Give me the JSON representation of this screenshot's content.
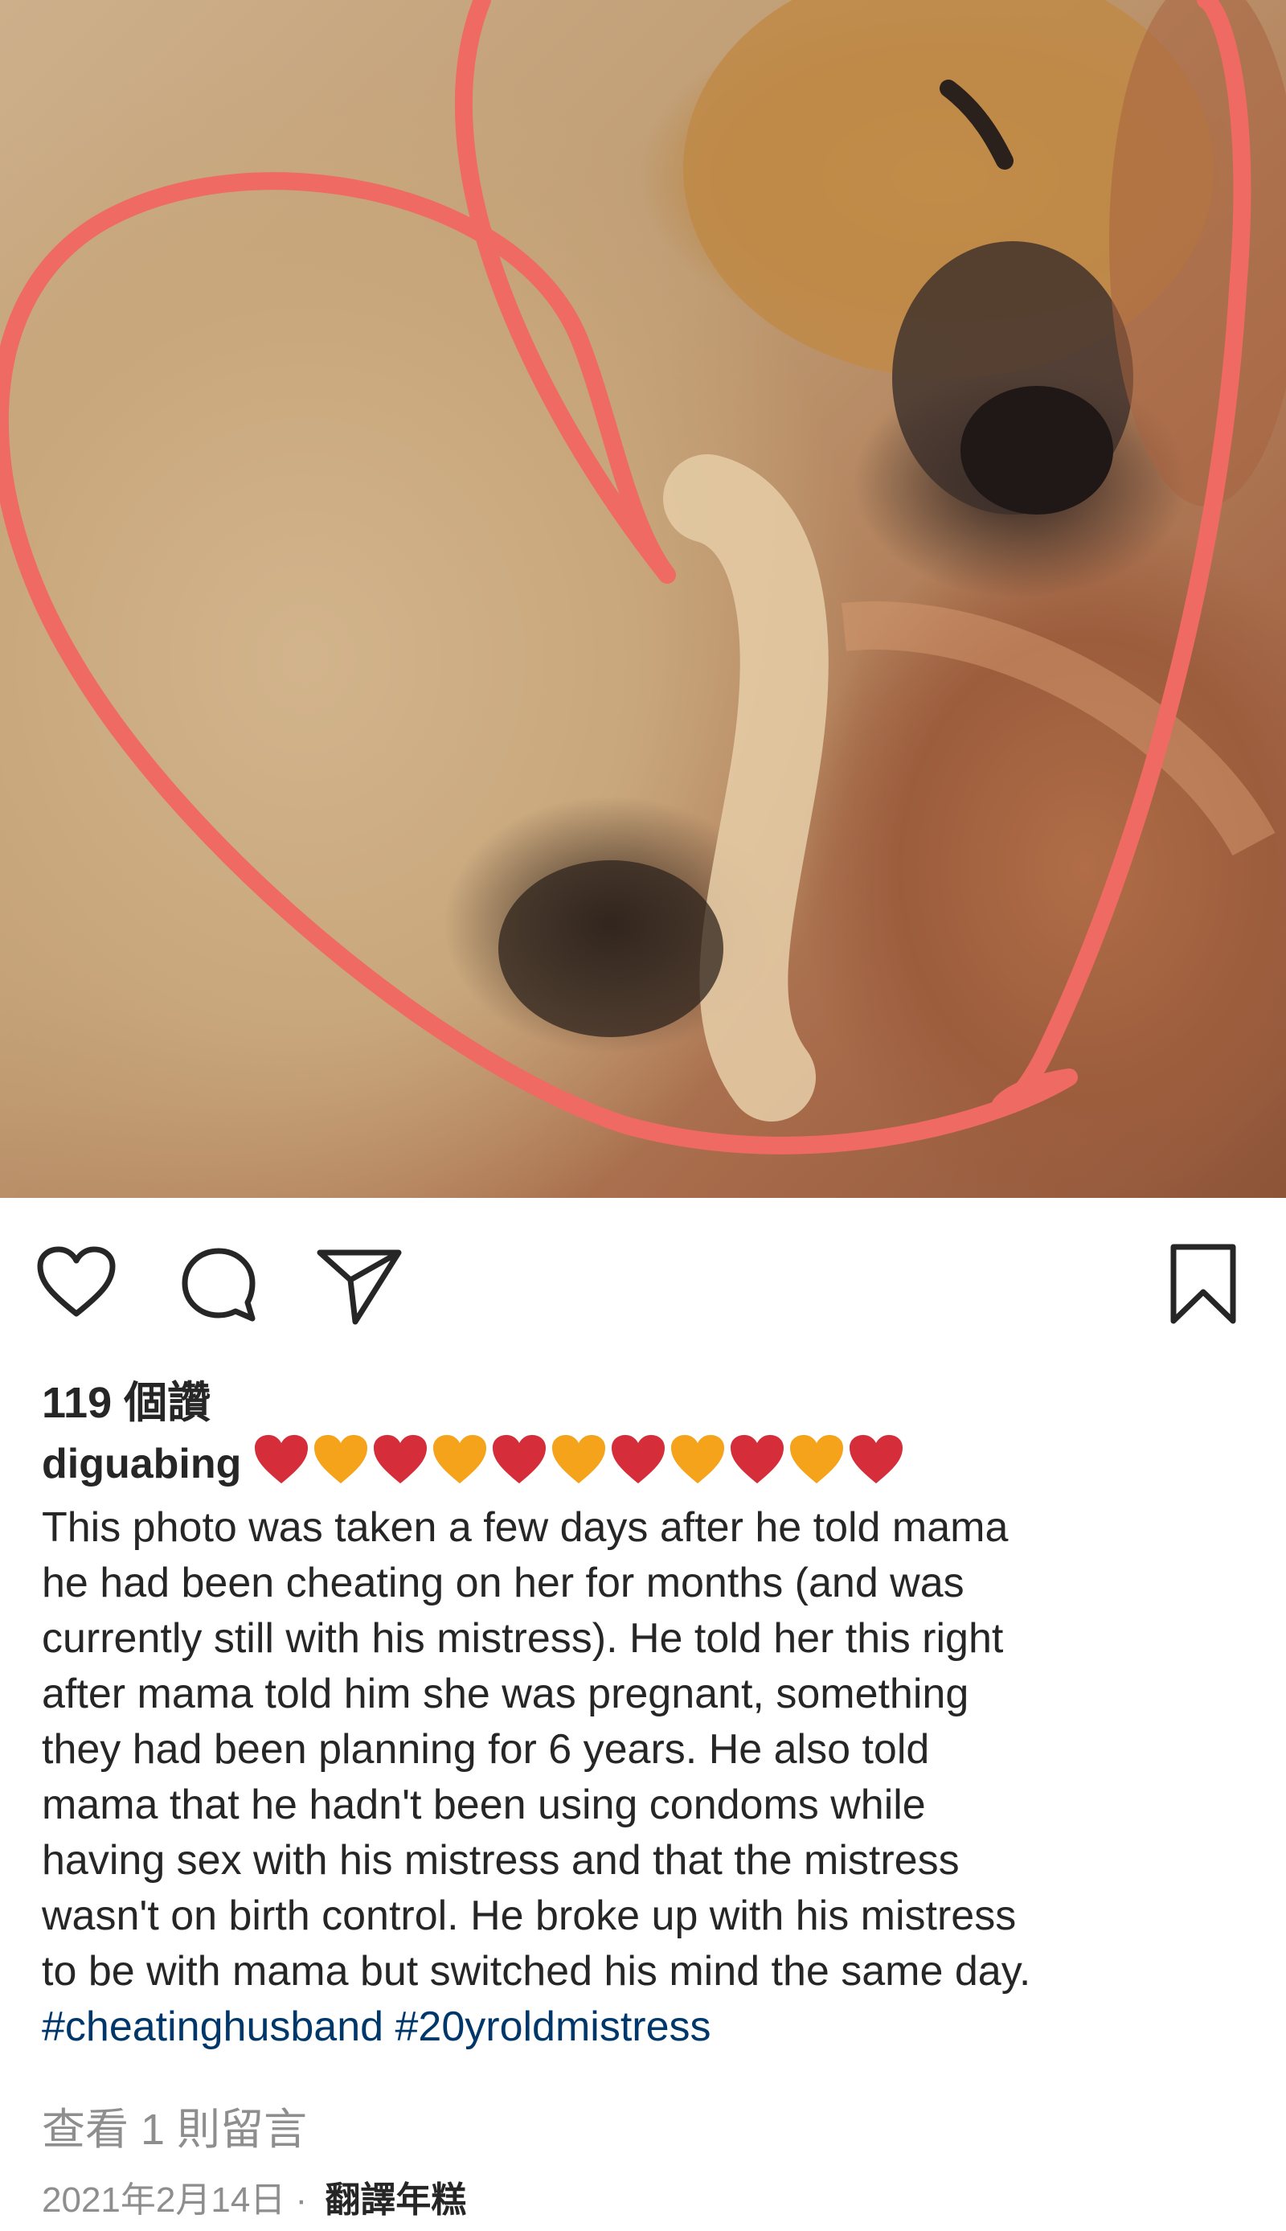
{
  "post": {
    "likes_text": "119 個讚",
    "username": "diguabing",
    "heart_emojis": [
      "red",
      "orange",
      "red",
      "orange",
      "red",
      "orange",
      "red",
      "orange",
      "red",
      "orange",
      "red"
    ],
    "caption_lines": [
      "This photo was taken a few days after he told mama",
      "he had been cheating on her for months (and was",
      "currently still with his mistress). He told her this right",
      "after mama told him she was pregnant, something",
      "they had been planning for 6 years. He also told",
      "mama that he hadn't been using condoms while",
      "having sex with his mistress and that the mistress",
      "wasn't on birth control. He broke up with his mistress",
      "to be with mama but switched his mind the same day."
    ],
    "hashtags": [
      "#cheatinghusband",
      "#20yroldmistress"
    ],
    "view_comments_text": "查看 1 則留言",
    "date_text": "2021年2月14日",
    "date_separator": " · ",
    "translate_text": "翻譯年糕"
  },
  "colors": {
    "heart_red": "#d62d3a",
    "heart_orange": "#f5a31a",
    "drawn_heart": "#ef6a62",
    "hashtag": "#00376b",
    "muted": "#8e8e8e"
  },
  "icons": {
    "like": "heart-outline-icon",
    "comment": "speech-bubble-icon",
    "share": "paper-plane-icon",
    "save": "bookmark-icon"
  }
}
